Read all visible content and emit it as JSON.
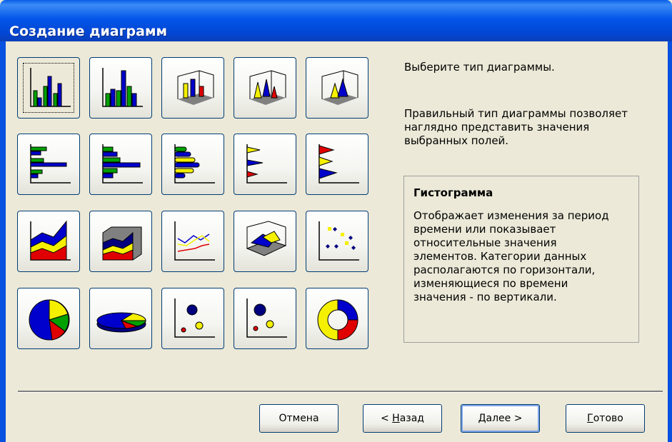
{
  "window": {
    "title": "Создание диаграмм"
  },
  "prompt": "Выберите тип диаграммы.",
  "hint": "Правильный тип диаграммы позволяет наглядно представить значения выбранных полей.",
  "description": {
    "title": "Гистограмма",
    "body": "Отображает изменения за период\nвремени или показывает\nотносительные значения\nэлементов. Категории данных\nрасполагаются по горизонтали,\nизменяющиеся по времени\nзначения - по вертикали."
  },
  "chart_types": [
    {
      "icon": "column-clustered-chart-icon",
      "selected": true
    },
    {
      "icon": "column-stacked-chart-icon",
      "selected": false
    },
    {
      "icon": "column-3d-chart-icon",
      "selected": false
    },
    {
      "icon": "cone-3d-chart-icon",
      "selected": false
    },
    {
      "icon": "pyramid-3d-chart-icon",
      "selected": false
    },
    {
      "icon": "bar-clustered-chart-icon",
      "selected": false
    },
    {
      "icon": "bar-stacked-chart-icon",
      "selected": false
    },
    {
      "icon": "bar-cylinder-chart-icon",
      "selected": false
    },
    {
      "icon": "bar-cone-chart-icon",
      "selected": false
    },
    {
      "icon": "bar-pyramid-chart-icon",
      "selected": false
    },
    {
      "icon": "area-chart-icon",
      "selected": false
    },
    {
      "icon": "area-3d-chart-icon",
      "selected": false
    },
    {
      "icon": "line-chart-icon",
      "selected": false
    },
    {
      "icon": "surface-3d-chart-icon",
      "selected": false
    },
    {
      "icon": "scatter-chart-icon",
      "selected": false
    },
    {
      "icon": "pie-chart-icon",
      "selected": false
    },
    {
      "icon": "pie-3d-chart-icon",
      "selected": false
    },
    {
      "icon": "bubble-chart-icon",
      "selected": false
    },
    {
      "icon": "bubble-3d-chart-icon",
      "selected": false
    },
    {
      "icon": "doughnut-chart-icon",
      "selected": false
    }
  ],
  "colors": {
    "blue": "#0000CC",
    "green": "#00A000",
    "red": "#E00000",
    "yellow": "#F4F000",
    "navy": "#00007F",
    "title_bar": "#0352E0",
    "face": "#ECE9D8"
  },
  "buttons": {
    "cancel": "Отмена",
    "back_prefix": "< ",
    "back_key": "Н",
    "back_rest": "азад",
    "next_key": "Д",
    "next_rest": "алее >",
    "finish_key": "Г",
    "finish_rest": "отово"
  }
}
